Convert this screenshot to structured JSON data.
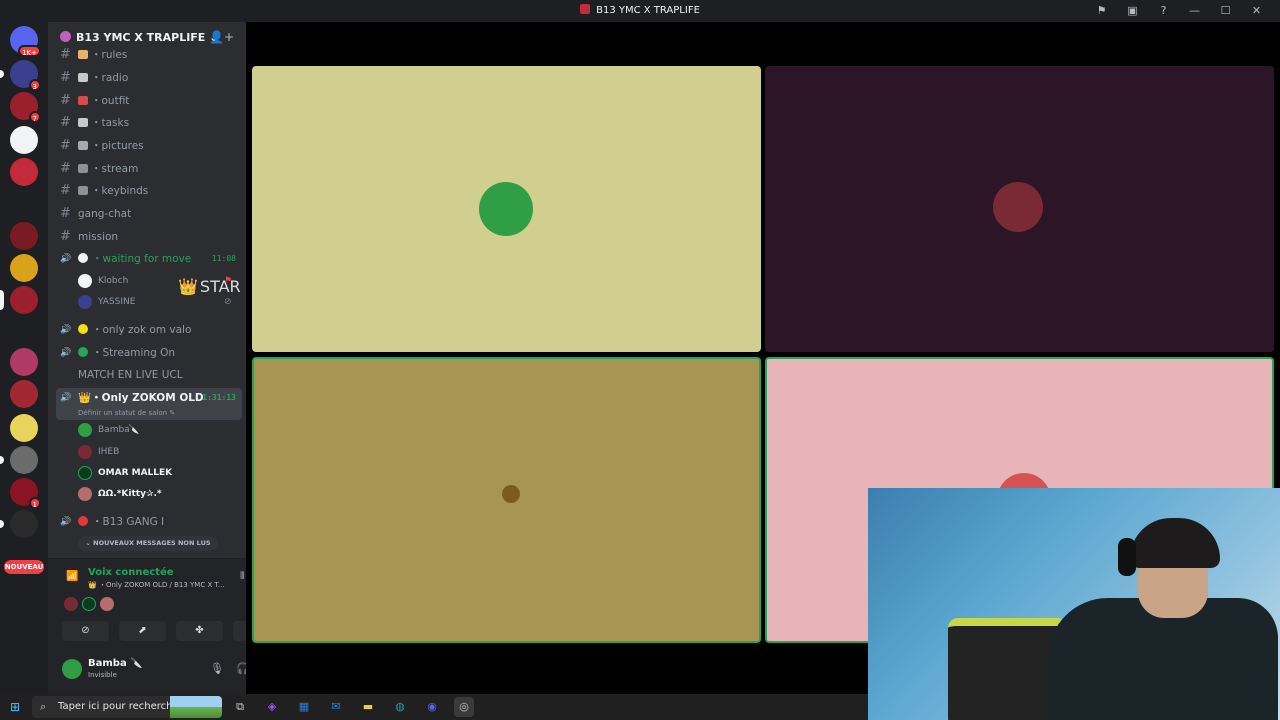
{
  "window": {
    "title": "B13 YMC X TRAPLIFE",
    "icons": [
      "inbox-icon",
      "screen-icon",
      "help-icon",
      "minimize",
      "maximize",
      "close"
    ],
    "icon_glyphs": [
      "⚑",
      "▣",
      "?",
      "—",
      "☐",
      "✕"
    ]
  },
  "servers": {
    "badges": [
      "1K+",
      "3",
      "7",
      "1"
    ],
    "nouveau_label": "NOUVEAU"
  },
  "server_header": {
    "name": "B13 YMC X TRAPLIFE",
    "chevron": "⌄",
    "invite_icon": "👤+"
  },
  "channels": {
    "text": [
      {
        "label": "rules",
        "emoji_color": "#e8b26a"
      },
      {
        "label": "radio",
        "emoji_color": "#c7c9cc"
      },
      {
        "label": "outfit",
        "emoji_color": "#d94b4b"
      },
      {
        "label": "tasks",
        "emoji_color": "#c7c9cc"
      },
      {
        "label": "pictures",
        "emoji_color": "#a6a9ad"
      },
      {
        "label": "stream",
        "emoji_color": "#8e9297"
      },
      {
        "label": "keybinds",
        "emoji_color": "#8e9297"
      },
      {
        "label": "gang-chat",
        "emoji_color": ""
      },
      {
        "label": "mission",
        "emoji_color": ""
      }
    ],
    "voice_waiting": {
      "label": "waiting for move",
      "time": "11:08"
    },
    "waiting_users": [
      {
        "name": "Klobch",
        "tag": "STAR",
        "tag_emoji": "👑"
      },
      {
        "name": "YASSINE",
        "tag": "",
        "tag_emoji": ""
      }
    ],
    "voice_channels": [
      {
        "label": "only zok om valo",
        "color": "#f0e014"
      },
      {
        "label": "Streaming On",
        "color": "#23a55a"
      }
    ],
    "match_label": "MATCH EN LIVE UCL",
    "active_voice": {
      "label": "Only ZOKOM OLD",
      "time": "1:31:13",
      "status_hint": "Définir un statut de salon ✎"
    },
    "active_users": [
      {
        "name": "Bamba",
        "suffix": "🔪",
        "bold": false
      },
      {
        "name": "IHEB",
        "suffix": "",
        "bold": false
      },
      {
        "name": "OMAR MALLEK",
        "suffix": "",
        "bold": true
      },
      {
        "name": "ΩΩ.*Kitty✰.*",
        "suffix": "",
        "bold": true
      }
    ],
    "gang_label": "B13 GANG I",
    "new_messages": "⌄  NOUVEAUX MESSAGES NON LUS"
  },
  "voice_panel": {
    "status": "Voix connectée",
    "channel": "👑 ・Only ZOKOM OLD / B13 YMC X T...",
    "buttons": [
      "camera-off",
      "screen-share",
      "activities",
      "soundboard"
    ],
    "button_glyphs": [
      "⊘",
      "⬈",
      "✤",
      "♫"
    ]
  },
  "user_panel": {
    "name": "Bamba",
    "name_suffix": "🔪",
    "status": "Invisible",
    "icon_glyphs": [
      "🎙",
      "🎧",
      "⚙"
    ]
  },
  "stage": {
    "tiles": [
      {
        "bg": "#d0cf8f",
        "speaking": false,
        "avatar_color": "#2f9e44"
      },
      {
        "bg": "#2d1528",
        "speaking": false,
        "avatar_color": "#7a2a35"
      },
      {
        "bg": "#a89453",
        "speaking": true,
        "avatar_color": "#7a5b1e"
      },
      {
        "bg": "#e8b4b8",
        "speaking": true,
        "avatar_color": "#d65353"
      }
    ]
  },
  "taskbar": {
    "search_placeholder": "Taper ici pour rechercher",
    "apps": [
      "task-view",
      "copilot",
      "store",
      "mail",
      "explorer",
      "edge",
      "discord",
      "obs"
    ],
    "app_glyphs": [
      "⧉",
      "◈",
      "▦",
      "✉",
      "▬",
      "◍",
      "◉",
      "◎"
    ],
    "app_colors": [
      "#cfd2d6",
      "#8b5cf6",
      "#2f7bd7",
      "#1e88e5",
      "#f2c94c",
      "#1ea0a0",
      "#5865f2",
      "#c4c4c4"
    ]
  }
}
